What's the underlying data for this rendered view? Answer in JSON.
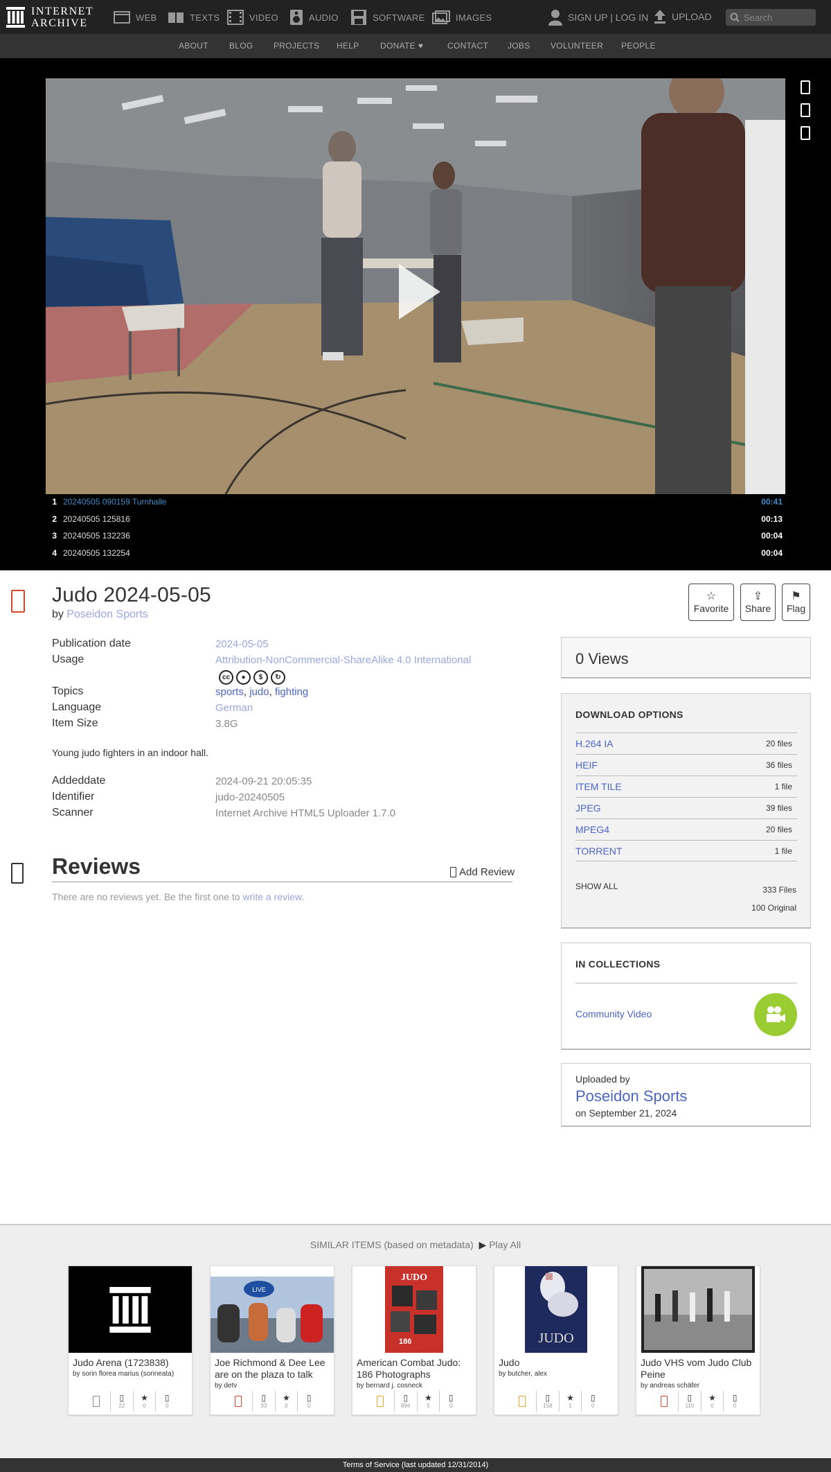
{
  "topnav": {
    "logo_line1": "INTERNET",
    "logo_line2": "ARCHIVE",
    "items": [
      {
        "label": "WEB",
        "icon": "web-icon"
      },
      {
        "label": "TEXTS",
        "icon": "book-icon"
      },
      {
        "label": "VIDEO",
        "icon": "film-icon"
      },
      {
        "label": "AUDIO",
        "icon": "speaker-icon"
      },
      {
        "label": "SOFTWARE",
        "icon": "floppy-icon"
      },
      {
        "label": "IMAGES",
        "icon": "images-icon"
      }
    ],
    "auth_label": "SIGN UP | LOG IN",
    "upload_label": "UPLOAD",
    "search_placeholder": "Search"
  },
  "subnav": [
    "ABOUT",
    "BLOG",
    "PROJECTS",
    "HELP",
    "DONATE",
    "CONTACT",
    "JOBS",
    "VOLUNTEER",
    "PEOPLE"
  ],
  "player": {
    "playlist": [
      {
        "num": "1",
        "title": "20240505 090159 Turnhalle",
        "time": "00:41",
        "active": true
      },
      {
        "num": "2",
        "title": "20240505 125816",
        "time": "00:13",
        "active": false
      },
      {
        "num": "3",
        "title": "20240505 132236",
        "time": "00:04",
        "active": false
      },
      {
        "num": "4",
        "title": "20240505 132254",
        "time": "00:04",
        "active": false
      }
    ]
  },
  "item": {
    "title": "Judo 2024-05-05",
    "by_prefix": "by",
    "creator": "Poseidon Sports",
    "actions": [
      {
        "label": "Favorite",
        "icon": "☆"
      },
      {
        "label": "Share",
        "icon": "⇪"
      },
      {
        "label": "Flag",
        "icon": "⚑"
      }
    ],
    "metadata": {
      "pubdate_label": "Publication date",
      "pubdate": "2024-05-05",
      "usage_label": "Usage",
      "usage": "Attribution-NonCommercial-ShareAlike 4.0 International",
      "topics_label": "Topics",
      "topics": [
        "sports",
        "judo",
        "fighting"
      ],
      "topic_sep": ",",
      "language_label": "Language",
      "language": "German",
      "size_label": "Item Size",
      "size": "3.8G",
      "description": "Young judo fighters in an indoor hall.",
      "addeddate_label": "Addeddate",
      "addeddate": "2024-09-21 20:05:35",
      "identifier_label": "Identifier",
      "identifier": "judo-20240505",
      "scanner_label": "Scanner",
      "scanner": "Internet Archive HTML5 Uploader 1.7.0"
    },
    "cc_icons": [
      "cc",
      "by",
      "nc",
      "sa"
    ]
  },
  "reviews": {
    "title": "Reviews",
    "add_label": "Add Review",
    "empty_text": "There are no reviews yet. Be the first one to",
    "empty_link": "write a review",
    "empty_end": "."
  },
  "sidebar": {
    "views": "0 Views",
    "download_title": "DOWNLOAD OPTIONS",
    "downloads": [
      {
        "format": "H.264 IA",
        "count": "20 files"
      },
      {
        "format": "HEIF",
        "count": "36 files"
      },
      {
        "format": "ITEM TILE",
        "count": "1 file"
      },
      {
        "format": "JPEG",
        "count": "39 files"
      },
      {
        "format": "MPEG4",
        "count": "20 files"
      },
      {
        "format": "TORRENT",
        "count": "1 file"
      }
    ],
    "show_all": "SHOW ALL",
    "total_files": "333 Files",
    "original_files": "100 Original",
    "collections_title": "IN COLLECTIONS",
    "collection": "Community Video",
    "uploaded_by_label": "Uploaded by",
    "uploader": "Poseidon Sports",
    "upload_date": "on September 21, 2024"
  },
  "similar": {
    "heading": "SIMILAR ITEMS (based on metadata)",
    "play_all": "Play All",
    "tiles": [
      {
        "title": "Judo Arena (1723838)",
        "by": "by sorin florea marius (sorineata)",
        "views": "22",
        "favs": "0",
        "reviews": "0"
      },
      {
        "title": "Joe Richmond & Dee Lee are on the plaza to talk",
        "by": "by detv",
        "views": "33",
        "favs": "0",
        "reviews": "0"
      },
      {
        "title": "American Combat Judo: 186 Photographs",
        "by": "by bernard j. cosneck",
        "views": "894",
        "favs": "5",
        "reviews": "0"
      },
      {
        "title": "Judo",
        "by": "by butcher, alex",
        "views": "158",
        "favs": "1",
        "reviews": "0"
      },
      {
        "title": "Judo VHS vom Judo Club Peine",
        "by": "by andreas schäfer",
        "views": "110",
        "favs": "0",
        "reviews": "0"
      }
    ],
    "thumb_texts": [
      "JUDO",
      "186",
      "JUDO",
      "LIVE"
    ]
  },
  "footer": "Terms of Service (last updated 12/31/2014)",
  "colors": {
    "accent": "#4b64c6",
    "link_light": "#9aa6de",
    "nav_bg": "#222222",
    "heart": "#ff0000",
    "badge": "#9acd32"
  }
}
